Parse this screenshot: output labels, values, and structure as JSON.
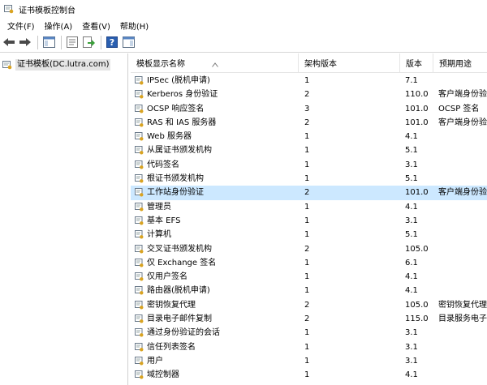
{
  "window": {
    "title": "证书模板控制台"
  },
  "menu": [
    "文件(F)",
    "操作(A)",
    "查看(V)",
    "帮助(H)"
  ],
  "toolbar": {
    "icons": [
      "back-arrow-icon",
      "forward-arrow-icon",
      "show-tree-icon",
      "properties-icon",
      "export-list-icon",
      "help-icon",
      "show-action-pane-icon"
    ]
  },
  "tree": {
    "root_label": "证书模板(DC.lutra.com)"
  },
  "list": {
    "columns": {
      "name": "模板显示名称",
      "schema": "架构版本",
      "version": "版本",
      "purpose": "预期用途"
    },
    "rows": [
      {
        "name": "IPSec (脱机申请)",
        "schema": "1",
        "version": "7.1",
        "purpose": ""
      },
      {
        "name": "Kerberos 身份验证",
        "schema": "2",
        "version": "110.0",
        "purpose": "客户端身份验"
      },
      {
        "name": "OCSP 响应签名",
        "schema": "3",
        "version": "101.0",
        "purpose": "OCSP 签名"
      },
      {
        "name": "RAS 和 IAS 服务器",
        "schema": "2",
        "version": "101.0",
        "purpose": "客户端身份验"
      },
      {
        "name": "Web 服务器",
        "schema": "1",
        "version": "4.1",
        "purpose": ""
      },
      {
        "name": "从属证书颁发机构",
        "schema": "1",
        "version": "5.1",
        "purpose": ""
      },
      {
        "name": "代码签名",
        "schema": "1",
        "version": "3.1",
        "purpose": ""
      },
      {
        "name": "根证书颁发机构",
        "schema": "1",
        "version": "5.1",
        "purpose": ""
      },
      {
        "name": "工作站身份验证",
        "schema": "2",
        "version": "101.0",
        "purpose": "客户端身份验"
      },
      {
        "name": "管理员",
        "schema": "1",
        "version": "4.1",
        "purpose": ""
      },
      {
        "name": "基本 EFS",
        "schema": "1",
        "version": "3.1",
        "purpose": ""
      },
      {
        "name": "计算机",
        "schema": "1",
        "version": "5.1",
        "purpose": ""
      },
      {
        "name": "交叉证书颁发机构",
        "schema": "2",
        "version": "105.0",
        "purpose": ""
      },
      {
        "name": "仅 Exchange 签名",
        "schema": "1",
        "version": "6.1",
        "purpose": ""
      },
      {
        "name": "仅用户签名",
        "schema": "1",
        "version": "4.1",
        "purpose": ""
      },
      {
        "name": "路由器(脱机申请)",
        "schema": "1",
        "version": "4.1",
        "purpose": ""
      },
      {
        "name": "密钥恢复代理",
        "schema": "2",
        "version": "105.0",
        "purpose": "密钥恢复代理"
      },
      {
        "name": "目录电子邮件复制",
        "schema": "2",
        "version": "115.0",
        "purpose": "目录服务电子"
      },
      {
        "name": "通过身份验证的会话",
        "schema": "1",
        "version": "3.1",
        "purpose": ""
      },
      {
        "name": "信任列表签名",
        "schema": "1",
        "version": "3.1",
        "purpose": ""
      },
      {
        "name": "用户",
        "schema": "1",
        "version": "3.1",
        "purpose": ""
      },
      {
        "name": "域控制器",
        "schema": "1",
        "version": "4.1",
        "purpose": ""
      }
    ],
    "selected_row": "工作站身份验证"
  },
  "colors": {
    "selection": "#cce8ff",
    "header_divider": "#e5e5e5",
    "tree_label_bg": "#e5e5e5"
  }
}
